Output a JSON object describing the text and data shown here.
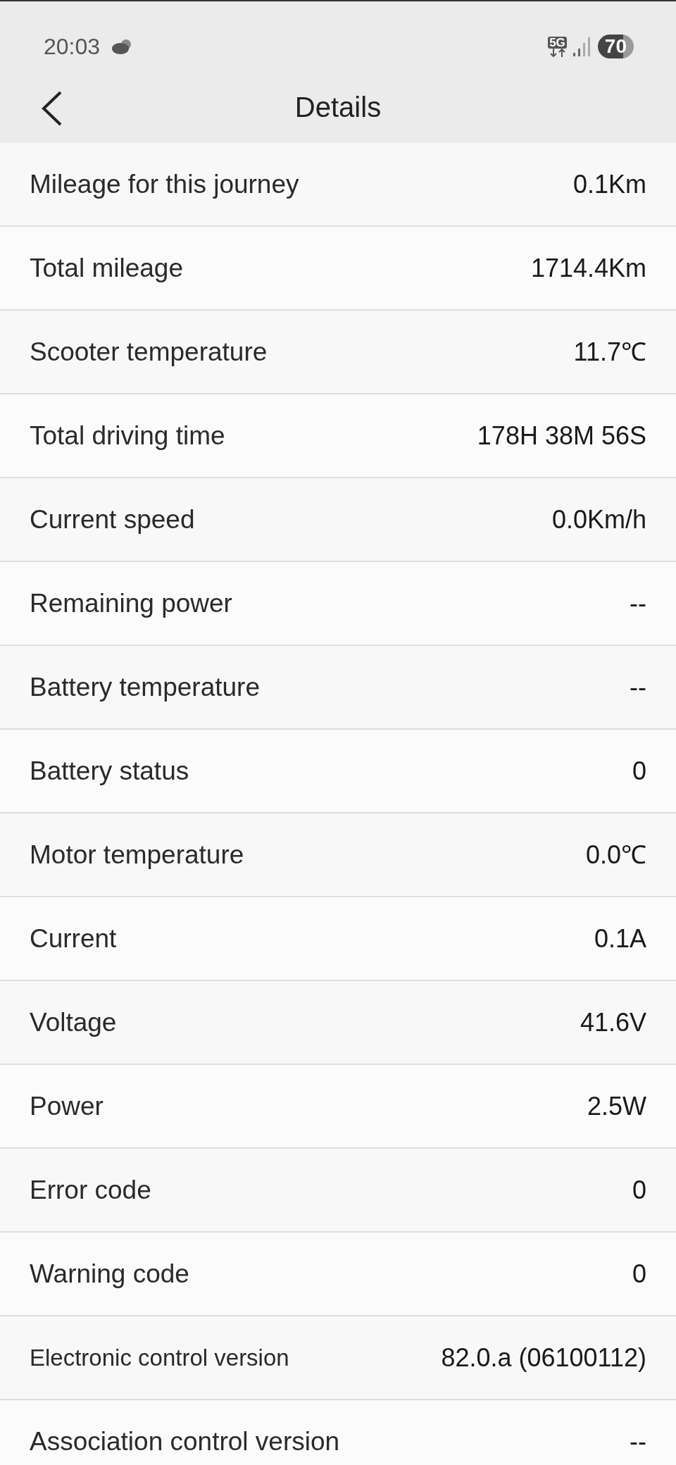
{
  "status_bar": {
    "time": "20:03",
    "network": "5G",
    "battery": "70"
  },
  "header": {
    "title": "Details"
  },
  "rows": [
    {
      "label": "Mileage for this journey",
      "value": "0.1Km",
      "kind": "standard"
    },
    {
      "label": "Total mileage",
      "value": "1714.4Km",
      "kind": "standard"
    },
    {
      "label": "Scooter temperature",
      "value": "11.7℃",
      "kind": "standard"
    },
    {
      "label": "Total driving time",
      "value": "178H 38M 56S",
      "kind": "standard"
    },
    {
      "label": "Current speed",
      "value": "0.0Km/h",
      "kind": "standard"
    },
    {
      "label": "Remaining power",
      "value": "--",
      "kind": "standard"
    },
    {
      "label": "Battery temperature",
      "value": "--",
      "kind": "standard"
    },
    {
      "label": "Battery status",
      "value": "0",
      "kind": "standard"
    },
    {
      "label": "Motor temperature",
      "value": "0.0℃",
      "kind": "standard"
    },
    {
      "label": "Current",
      "value": "0.1A",
      "kind": "standard"
    },
    {
      "label": "Voltage",
      "value": "41.6V",
      "kind": "standard"
    },
    {
      "label": "Power",
      "value": "2.5W",
      "kind": "standard"
    },
    {
      "label": "Error code",
      "value": "0",
      "kind": "standard"
    },
    {
      "label": "Warning code",
      "value": "0",
      "kind": "standard"
    },
    {
      "label": "Electronic control version",
      "value": "82.0.a (06100112)",
      "kind": "compact"
    },
    {
      "label": "Association control version",
      "value": "--",
      "kind": "standard"
    }
  ]
}
